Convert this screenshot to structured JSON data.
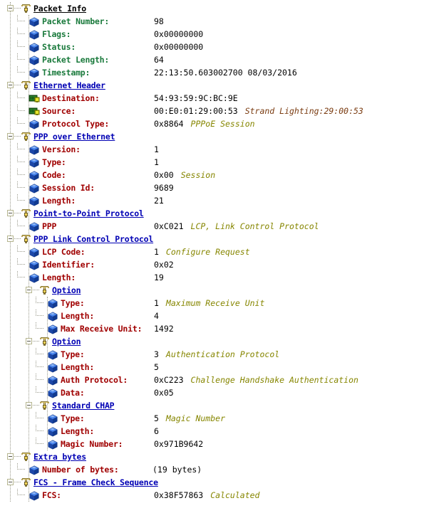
{
  "window": {
    "title": "Packet Decode Tree"
  },
  "colors": {
    "node_title": "#0000b4",
    "field_label_green": "#1a7a3c",
    "field_label_red": "#a00000",
    "annotation_olive": "#868600",
    "annotation_brown": "#7a3b10",
    "value_text": "#000000",
    "tree_line": "#9a9a8c",
    "background": "#ffffff"
  },
  "icons": {
    "node": "network-node-icon",
    "field": "blue-cube-icon",
    "adapter": "network-adapter-icon",
    "expander": "expander-minus-box-icon"
  },
  "tree": [
    {
      "id": "packet-info",
      "type": "node",
      "depth": 0,
      "icon": "network-node-icon",
      "label": "Packet Info",
      "underline": false,
      "title_color": "black",
      "expanded": true
    },
    {
      "id": "packet-number",
      "type": "field",
      "depth": 1,
      "icon": "blue-cube-icon",
      "label": "Packet Number:",
      "label_color": "green",
      "value": "98",
      "annotation": "",
      "annotation_color": ""
    },
    {
      "id": "flags",
      "type": "field",
      "depth": 1,
      "icon": "blue-cube-icon",
      "label": "Flags:",
      "label_color": "green",
      "value": "0x00000000",
      "annotation": "",
      "annotation_color": ""
    },
    {
      "id": "status",
      "type": "field",
      "depth": 1,
      "icon": "blue-cube-icon",
      "label": "Status:",
      "label_color": "green",
      "value": "0x00000000",
      "annotation": "",
      "annotation_color": ""
    },
    {
      "id": "packet-length",
      "type": "field",
      "depth": 1,
      "icon": "blue-cube-icon",
      "label": "Packet Length:",
      "label_color": "green",
      "value": "64",
      "annotation": "",
      "annotation_color": ""
    },
    {
      "id": "timestamp",
      "type": "field",
      "depth": 1,
      "icon": "blue-cube-icon",
      "label": "Timestamp:",
      "label_color": "green",
      "value": "22:13:50.603002700 08/03/2016",
      "annotation": "",
      "annotation_color": ""
    },
    {
      "id": "ethernet-header",
      "type": "node",
      "depth": 0,
      "icon": "network-node-icon",
      "label": "Ethernet Header",
      "underline": true,
      "title_color": "blue",
      "expanded": true
    },
    {
      "id": "destination",
      "type": "field",
      "depth": 1,
      "icon": "network-adapter-icon",
      "label": "Destination:",
      "label_color": "red",
      "value": "54:93:59:9C:BC:9E",
      "annotation": "",
      "annotation_color": ""
    },
    {
      "id": "source",
      "type": "field",
      "depth": 1,
      "icon": "network-adapter-icon",
      "label": "Source:",
      "label_color": "red",
      "value": "00:E0:01:29:00:53",
      "annotation": "Strand Lighting:29:00:53",
      "annotation_color": "brown"
    },
    {
      "id": "protocol-type",
      "type": "field",
      "depth": 1,
      "icon": "blue-cube-icon",
      "label": "Protocol Type:",
      "label_color": "red",
      "value": "0x8864",
      "annotation": "PPPoE Session",
      "annotation_color": "olive"
    },
    {
      "id": "ppp-over-ethernet",
      "type": "node",
      "depth": 0,
      "icon": "network-node-icon",
      "label": "PPP over Ethernet",
      "underline": true,
      "title_color": "blue",
      "expanded": true
    },
    {
      "id": "version",
      "type": "field",
      "depth": 1,
      "icon": "blue-cube-icon",
      "label": "Version:",
      "label_color": "red",
      "value": "1",
      "annotation": "",
      "annotation_color": ""
    },
    {
      "id": "type-pppoe",
      "type": "field",
      "depth": 1,
      "icon": "blue-cube-icon",
      "label": "Type:",
      "label_color": "red",
      "value": "1",
      "annotation": "",
      "annotation_color": ""
    },
    {
      "id": "code",
      "type": "field",
      "depth": 1,
      "icon": "blue-cube-icon",
      "label": "Code:",
      "label_color": "red",
      "value": "0x00",
      "annotation": "Session",
      "annotation_color": "olive"
    },
    {
      "id": "session-id",
      "type": "field",
      "depth": 1,
      "icon": "blue-cube-icon",
      "label": "Session Id:",
      "label_color": "red",
      "value": "9689",
      "annotation": "",
      "annotation_color": ""
    },
    {
      "id": "length-pppoe",
      "type": "field",
      "depth": 1,
      "icon": "blue-cube-icon",
      "label": "Length:",
      "label_color": "red",
      "value": "21",
      "annotation": "",
      "annotation_color": ""
    },
    {
      "id": "point-to-point-protocol",
      "type": "node",
      "depth": 0,
      "icon": "network-node-icon",
      "label": "Point-to-Point Protocol",
      "underline": true,
      "title_color": "blue",
      "expanded": true
    },
    {
      "id": "ppp",
      "type": "field",
      "depth": 1,
      "icon": "blue-cube-icon",
      "label": "PPP",
      "label_color": "red",
      "value": "0xC021",
      "annotation": "LCP, Link Control Protocol",
      "annotation_color": "olive"
    },
    {
      "id": "ppp-link-control-protocol",
      "type": "node",
      "depth": 0,
      "icon": "network-node-icon",
      "label": "PPP Link Control Protocol",
      "underline": true,
      "title_color": "blue",
      "expanded": true
    },
    {
      "id": "lcp-code",
      "type": "field",
      "depth": 1,
      "icon": "blue-cube-icon",
      "label": "LCP Code:",
      "label_color": "red",
      "value": "1",
      "annotation": "Configure Request",
      "annotation_color": "olive"
    },
    {
      "id": "identifier",
      "type": "field",
      "depth": 1,
      "icon": "blue-cube-icon",
      "label": "Identifier:",
      "label_color": "red",
      "value": "0x02",
      "annotation": "",
      "annotation_color": ""
    },
    {
      "id": "length-lcp",
      "type": "field",
      "depth": 1,
      "icon": "blue-cube-icon",
      "label": "Length:",
      "label_color": "red",
      "value": "19",
      "annotation": "",
      "annotation_color": ""
    },
    {
      "id": "option-1",
      "type": "node",
      "depth": 1,
      "icon": "network-node-icon",
      "label": "Option",
      "underline": true,
      "title_color": "blue",
      "expanded": true
    },
    {
      "id": "option1-type",
      "type": "field",
      "depth": 2,
      "icon": "blue-cube-icon",
      "label": "Type:",
      "label_color": "red",
      "value": "1",
      "annotation": "Maximum Receive Unit",
      "annotation_color": "olive"
    },
    {
      "id": "option1-length",
      "type": "field",
      "depth": 2,
      "icon": "blue-cube-icon",
      "label": "Length:",
      "label_color": "red",
      "value": "4",
      "annotation": "",
      "annotation_color": ""
    },
    {
      "id": "max-receive-unit",
      "type": "field",
      "depth": 2,
      "icon": "blue-cube-icon",
      "label": "Max Receive Unit:",
      "label_color": "red",
      "value": "1492",
      "annotation": "",
      "annotation_color": ""
    },
    {
      "id": "option-2",
      "type": "node",
      "depth": 1,
      "icon": "network-node-icon",
      "label": "Option",
      "underline": true,
      "title_color": "blue",
      "expanded": true
    },
    {
      "id": "option2-type",
      "type": "field",
      "depth": 2,
      "icon": "blue-cube-icon",
      "label": "Type:",
      "label_color": "red",
      "value": "3",
      "annotation": "Authentication Protocol",
      "annotation_color": "olive"
    },
    {
      "id": "option2-length",
      "type": "field",
      "depth": 2,
      "icon": "blue-cube-icon",
      "label": "Length:",
      "label_color": "red",
      "value": "5",
      "annotation": "",
      "annotation_color": ""
    },
    {
      "id": "auth-protocol",
      "type": "field",
      "depth": 2,
      "icon": "blue-cube-icon",
      "label": "Auth Protocol:",
      "label_color": "red",
      "value": "0xC223",
      "annotation": "Challenge Handshake Authentication",
      "annotation_color": "olive"
    },
    {
      "id": "data",
      "type": "field",
      "depth": 2,
      "icon": "blue-cube-icon",
      "label": "Data:",
      "label_color": "red",
      "value": "0x05",
      "annotation": "",
      "annotation_color": ""
    },
    {
      "id": "standard-chap",
      "type": "node",
      "depth": 1,
      "icon": "network-node-icon",
      "label": "Standard CHAP",
      "underline": true,
      "title_color": "blue",
      "expanded": true
    },
    {
      "id": "chap-type",
      "type": "field",
      "depth": 2,
      "icon": "blue-cube-icon",
      "label": "Type:",
      "label_color": "red",
      "value": "5",
      "annotation": "Magic Number",
      "annotation_color": "olive"
    },
    {
      "id": "chap-length",
      "type": "field",
      "depth": 2,
      "icon": "blue-cube-icon",
      "label": "Length:",
      "label_color": "red",
      "value": "6",
      "annotation": "",
      "annotation_color": ""
    },
    {
      "id": "magic-number",
      "type": "field",
      "depth": 2,
      "icon": "blue-cube-icon",
      "label": "Magic Number:",
      "label_color": "red",
      "value": "0x971B9642",
      "annotation": "",
      "annotation_color": ""
    },
    {
      "id": "extra-bytes",
      "type": "node",
      "depth": 0,
      "icon": "network-node-icon",
      "label": "Extra bytes",
      "underline": true,
      "title_color": "blue",
      "expanded": true
    },
    {
      "id": "number-of-bytes",
      "type": "field",
      "depth": 1,
      "icon": "blue-cube-icon",
      "label": "Number of bytes:",
      "label_color": "red",
      "value": "(19 bytes)",
      "annotation": "",
      "annotation_color": "",
      "value_offset": 214
    },
    {
      "id": "fcs-frame-check-sequence",
      "type": "node",
      "depth": 0,
      "icon": "network-node-icon",
      "label": "FCS - Frame Check Sequence",
      "underline": true,
      "title_color": "blue",
      "expanded": true
    },
    {
      "id": "fcs",
      "type": "field",
      "depth": 1,
      "icon": "blue-cube-icon",
      "label": "FCS:",
      "label_color": "red",
      "value": "0x38F57863",
      "annotation": "Calculated",
      "annotation_color": "olive"
    }
  ]
}
